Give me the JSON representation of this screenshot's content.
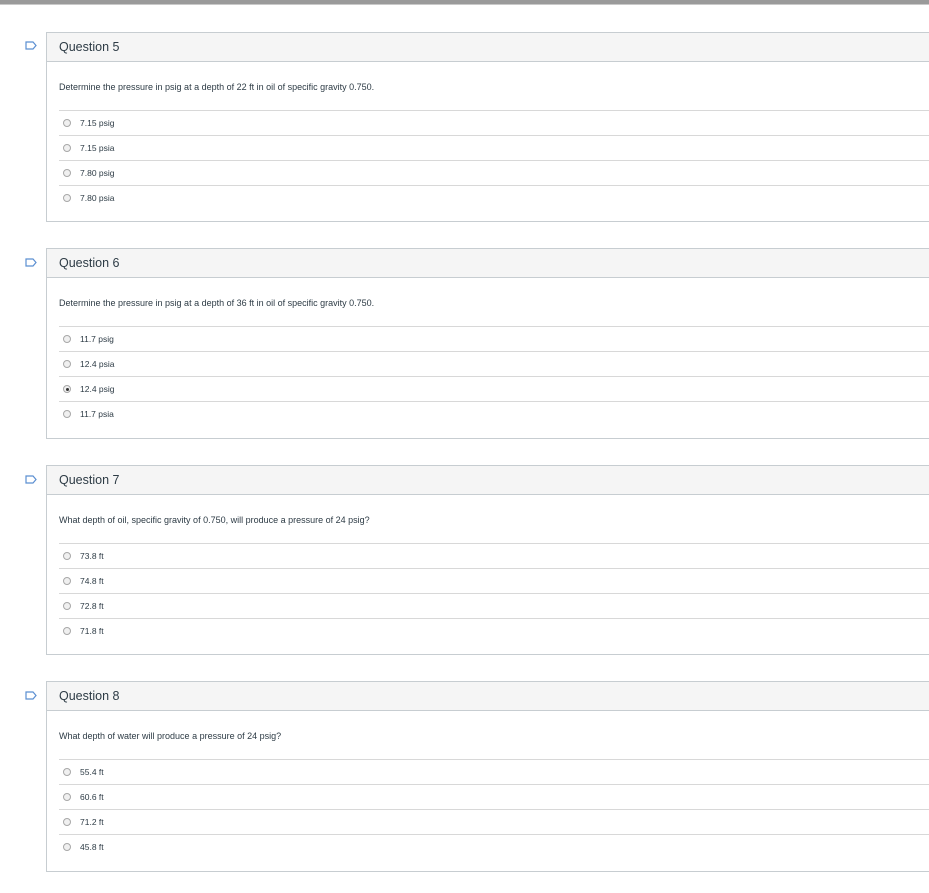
{
  "questions": [
    {
      "title": "Question 5",
      "text": "Determine the pressure in psig at a depth of 22 ft in oil of specific gravity 0.750.",
      "answers": [
        "7.15 psig",
        "7.15 psia",
        "7.80 psig",
        "7.80 psia"
      ],
      "selected": null
    },
    {
      "title": "Question 6",
      "text": "Determine the pressure in psig at a depth of 36 ft in oil of specific gravity 0.750.",
      "answers": [
        "11.7 psig",
        "12.4 psia",
        "12.4 psig",
        "11.7 psia"
      ],
      "selected": 2
    },
    {
      "title": "Question 7",
      "text": "What depth of oil, specific gravity of 0.750, will produce a pressure of 24 psig?",
      "answers": [
        "73.8 ft",
        "74.8 ft",
        "72.8 ft",
        "71.8 ft"
      ],
      "selected": null
    },
    {
      "title": "Question 8",
      "text": "What depth of water will produce a pressure of 24 psig?",
      "answers": [
        "55.4 ft",
        "60.6 ft",
        "71.2 ft",
        "45.8 ft"
      ],
      "selected": null
    }
  ],
  "colors": {
    "flag": "#5b8fd1",
    "header_bg": "#f5f5f5",
    "border": "#c7cdd1"
  },
  "icons": {
    "flag": "flag-question-icon"
  }
}
